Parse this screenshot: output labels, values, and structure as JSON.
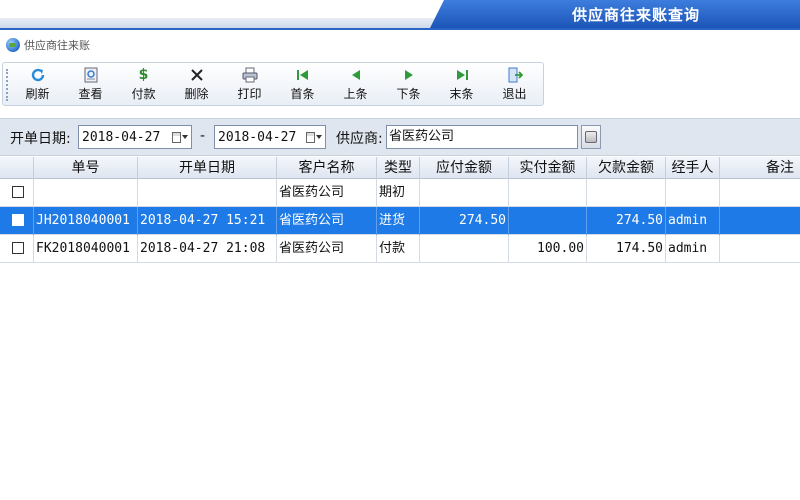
{
  "window": {
    "title": "供应商往来账查询"
  },
  "breadcrumb": {
    "label": "供应商往来账"
  },
  "toolbar": {
    "buttons": [
      {
        "label": "刷新",
        "icon": "refresh-icon"
      },
      {
        "label": "查看",
        "icon": "view-icon"
      },
      {
        "label": "付款",
        "icon": "payment-icon"
      },
      {
        "label": "删除",
        "icon": "delete-icon"
      },
      {
        "label": "打印",
        "icon": "print-icon"
      },
      {
        "label": "首条",
        "icon": "first-record-icon"
      },
      {
        "label": "上条",
        "icon": "previous-record-icon"
      },
      {
        "label": "下条",
        "icon": "next-record-icon"
      },
      {
        "label": "末条",
        "icon": "last-record-icon"
      },
      {
        "label": "退出",
        "icon": "exit-icon"
      }
    ]
  },
  "filter": {
    "date_label": "开单日期:",
    "date_from": "2018-04-27",
    "range_sep": "-",
    "date_to": "2018-04-27",
    "supplier_label": "供应商:",
    "supplier_value": "省医药公司"
  },
  "grid": {
    "columns": [
      "单号",
      "开单日期",
      "客户名称",
      "类型",
      "应付金额",
      "实付金额",
      "欠款金额",
      "经手人",
      "备注"
    ],
    "rows": [
      {
        "no": "",
        "date": "",
        "customer": "省医药公司",
        "type": "期初",
        "payable": "",
        "paid": "",
        "owed": "",
        "handler": "",
        "note": "",
        "selected": false
      },
      {
        "no": "JH2018040001",
        "date": "2018-04-27 15:21",
        "customer": "省医药公司",
        "type": "进货",
        "payable": "274.50",
        "paid": "",
        "owed": "274.50",
        "handler": "admin",
        "note": "",
        "selected": true
      },
      {
        "no": "FK2018040001",
        "date": "2018-04-27 21:08",
        "customer": "省医药公司",
        "type": "付款",
        "payable": "",
        "paid": "100.00",
        "owed": "174.50",
        "handler": "admin",
        "note": "",
        "selected": false
      }
    ]
  },
  "colors": {
    "accent": "#1e7ae6",
    "banner": "#2a64c4",
    "selected_row": "#1e7ae6"
  }
}
